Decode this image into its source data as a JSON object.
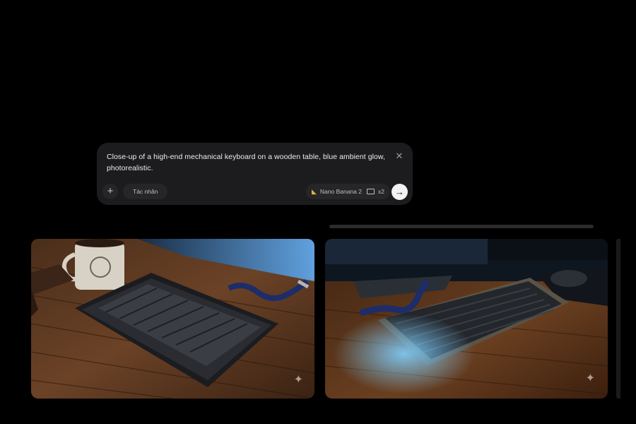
{
  "prompt": {
    "text": "Close-up of a high-end mechanical keyboard on a wooden table, blue ambient glow, photorealistic.",
    "close_label": "✕",
    "add_label": "+",
    "agent_label": "Tác nhân",
    "model_label": "Nano Banana 2",
    "count_label": "x2",
    "send_label": "→"
  },
  "results": {
    "images": [
      {
        "name": "keyboard-image-1",
        "badge": "✦"
      },
      {
        "name": "keyboard-image-2",
        "badge": "✦"
      }
    ]
  },
  "colors": {
    "background": "#000000",
    "card": "#1c1c1e",
    "chip": "#262628",
    "send": "#f2f2f2"
  }
}
